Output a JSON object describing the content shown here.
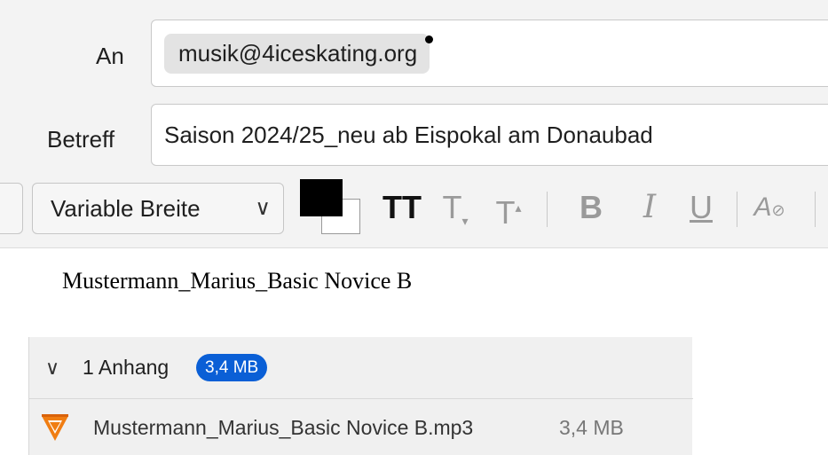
{
  "header": {
    "to_label": "An",
    "recipient": "musik@4iceskating.org",
    "subject_label": "Betreff",
    "subject_value": "Saison 2024/25_neu ab Eispokal am Donaubad"
  },
  "toolbar": {
    "font_select_value": "Variable Breite",
    "text_color": "#000000",
    "background_color": "#ffffff",
    "smaller_text_glyph": "TT",
    "subscript_glyph": "T",
    "superscript_glyph": "T",
    "bold_glyph": "B",
    "italic_glyph": "I",
    "underline_glyph": "U",
    "clear_format_glyph": "A"
  },
  "body": {
    "text": "Mustermann_Marius_Basic Novice B"
  },
  "attachments": {
    "count_label": "1 Anhang",
    "total_size": "3,4 MB",
    "accent_color": "#0a5fd6",
    "items": [
      {
        "name": "Mustermann_Marius_Basic Novice B.mp3",
        "size": "3,4 MB",
        "icon": "vlc-media-icon"
      }
    ]
  }
}
